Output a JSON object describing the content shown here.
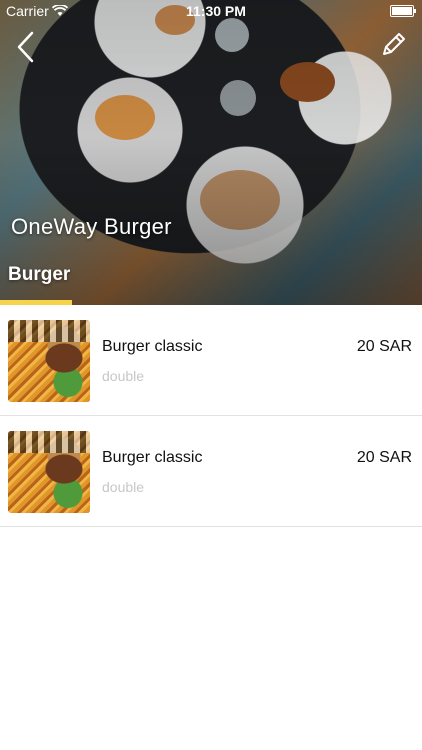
{
  "status_bar": {
    "carrier": "Carrier",
    "time": "11:30 PM"
  },
  "header": {
    "back_icon": "chevron-left-icon",
    "edit_icon": "pencil-icon",
    "restaurant_name": "OneWay Burger"
  },
  "tabs": [
    {
      "label": "Burger",
      "active": true
    }
  ],
  "colors": {
    "tab_indicator": "#f5d34a",
    "subtitle": "#c7c7c7",
    "divider": "#e2e2e2"
  },
  "menu_items": [
    {
      "title": "Burger classic",
      "subtitle": "double",
      "price": "20 SAR"
    },
    {
      "title": "Burger classic",
      "subtitle": "double",
      "price": "20 SAR"
    }
  ]
}
